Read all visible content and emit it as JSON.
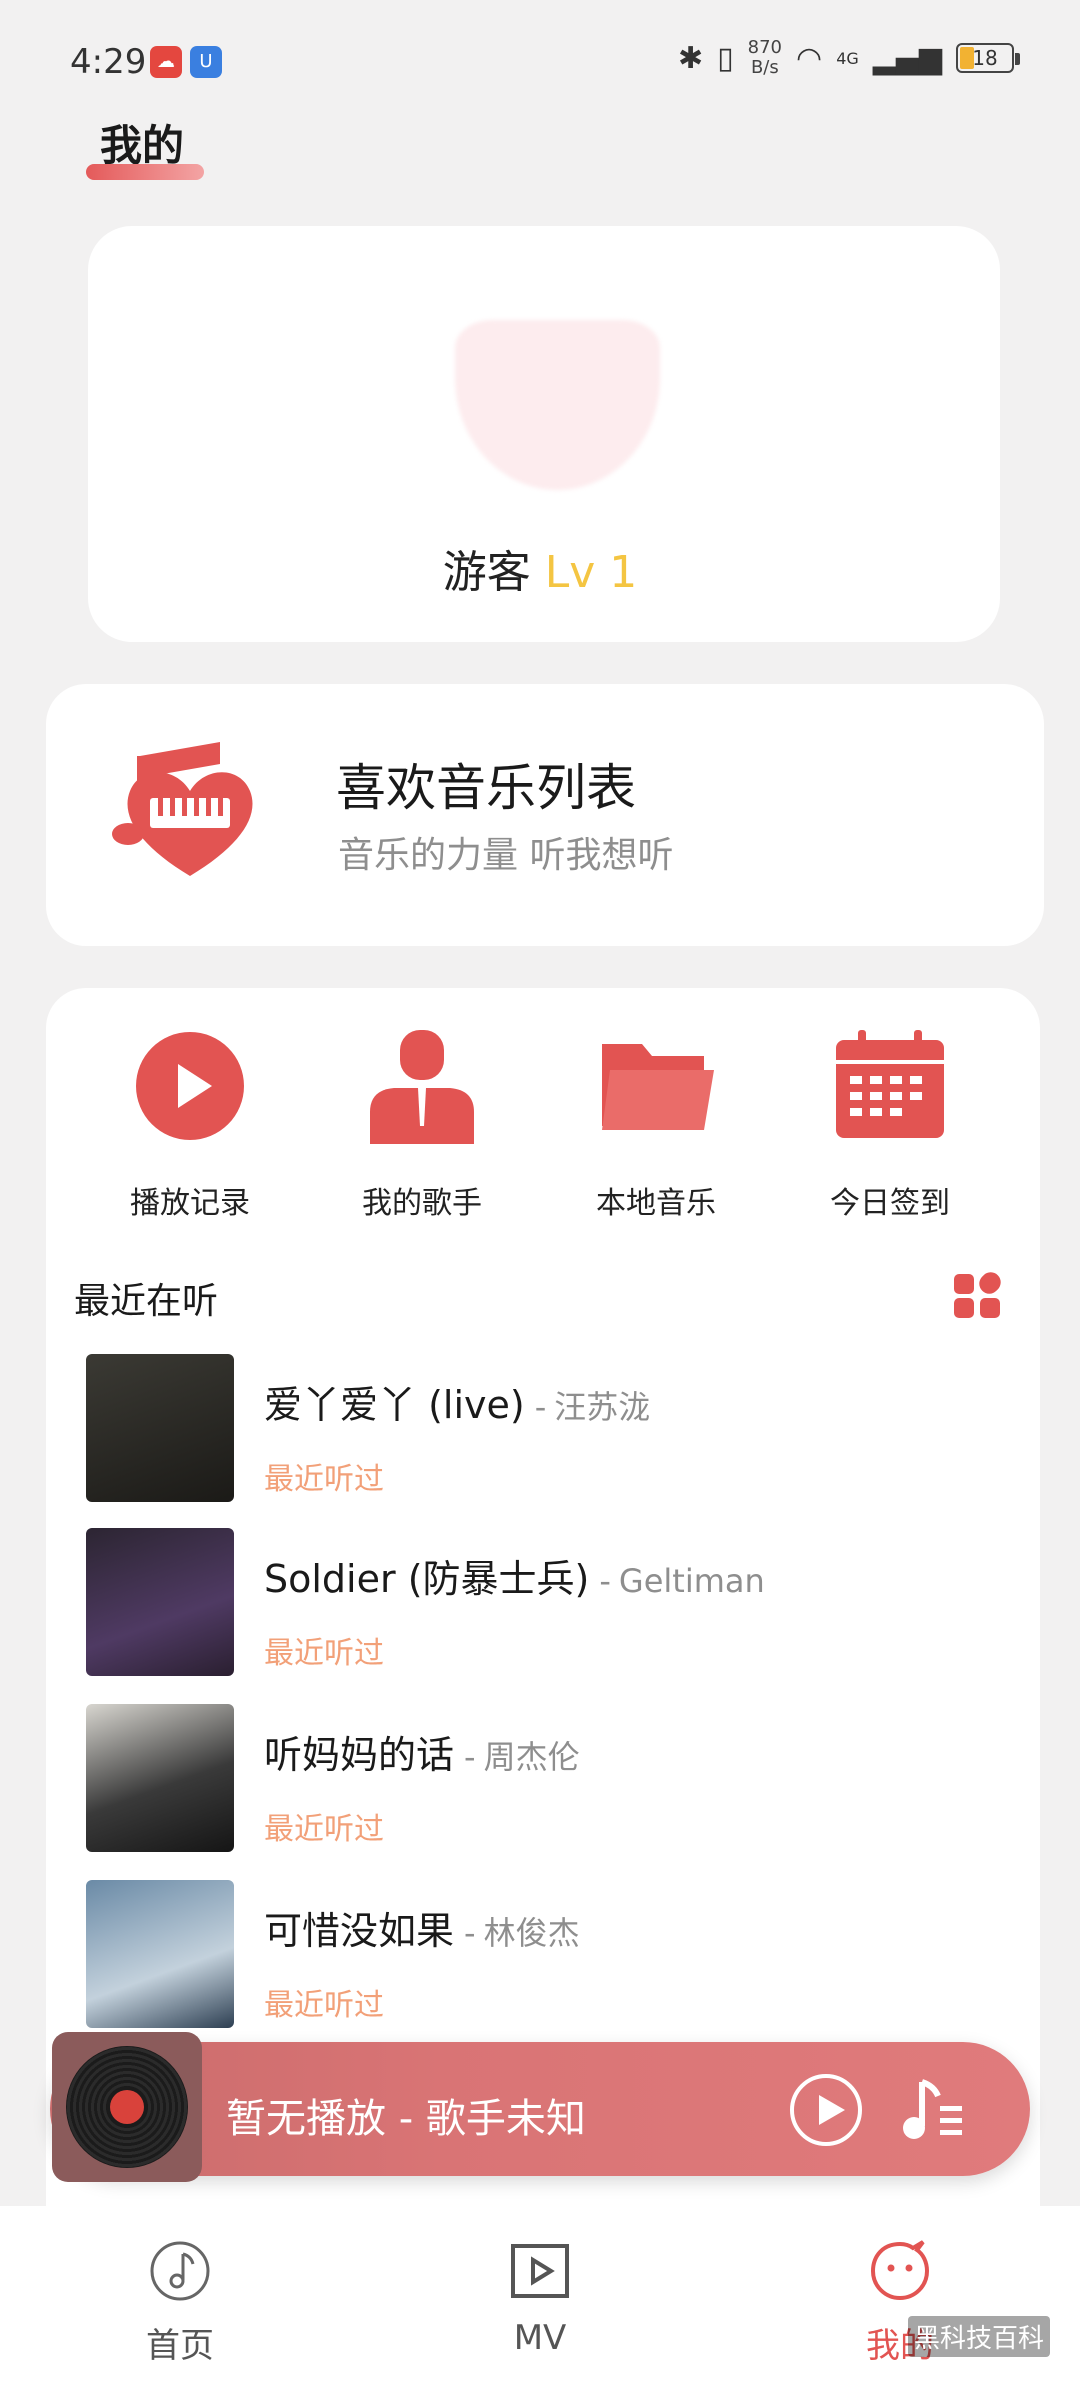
{
  "status_bar": {
    "time": "4:29",
    "net_rate_value": "870",
    "net_rate_unit": "B/s",
    "battery": "18",
    "network": "4G"
  },
  "page": {
    "title": "我的"
  },
  "profile": {
    "name": "游客",
    "level": "Lv 1"
  },
  "favorites": {
    "title": "喜欢音乐列表",
    "subtitle": "音乐的力量 听我想听"
  },
  "quick_actions": [
    {
      "label": "播放记录",
      "icon": "play-circle-icon"
    },
    {
      "label": "我的歌手",
      "icon": "singer-icon"
    },
    {
      "label": "本地音乐",
      "icon": "folder-icon"
    },
    {
      "label": "今日签到",
      "icon": "calendar-icon"
    }
  ],
  "recent": {
    "title": "最近在听",
    "tag": "最近听过",
    "songs": [
      {
        "title": "爱丫爱丫 (live)",
        "artist": "汪苏泷"
      },
      {
        "title": "Soldier (防暴士兵)",
        "artist": "Geltiman"
      },
      {
        "title": "听妈妈的话",
        "artist": "周杰伦"
      },
      {
        "title": "可惜没如果",
        "artist": "林俊杰"
      }
    ]
  },
  "player": {
    "text": "暂无播放 - 歌手未知"
  },
  "bottom_nav": [
    {
      "label": "首页",
      "icon": "music-note-icon"
    },
    {
      "label": "MV",
      "icon": "video-icon"
    },
    {
      "label": "我的",
      "icon": "mine-icon"
    }
  ],
  "watermark": "黑科技百科",
  "colors": {
    "accent": "#e25452",
    "tag": "#f2a078",
    "level": "#f4c542"
  }
}
